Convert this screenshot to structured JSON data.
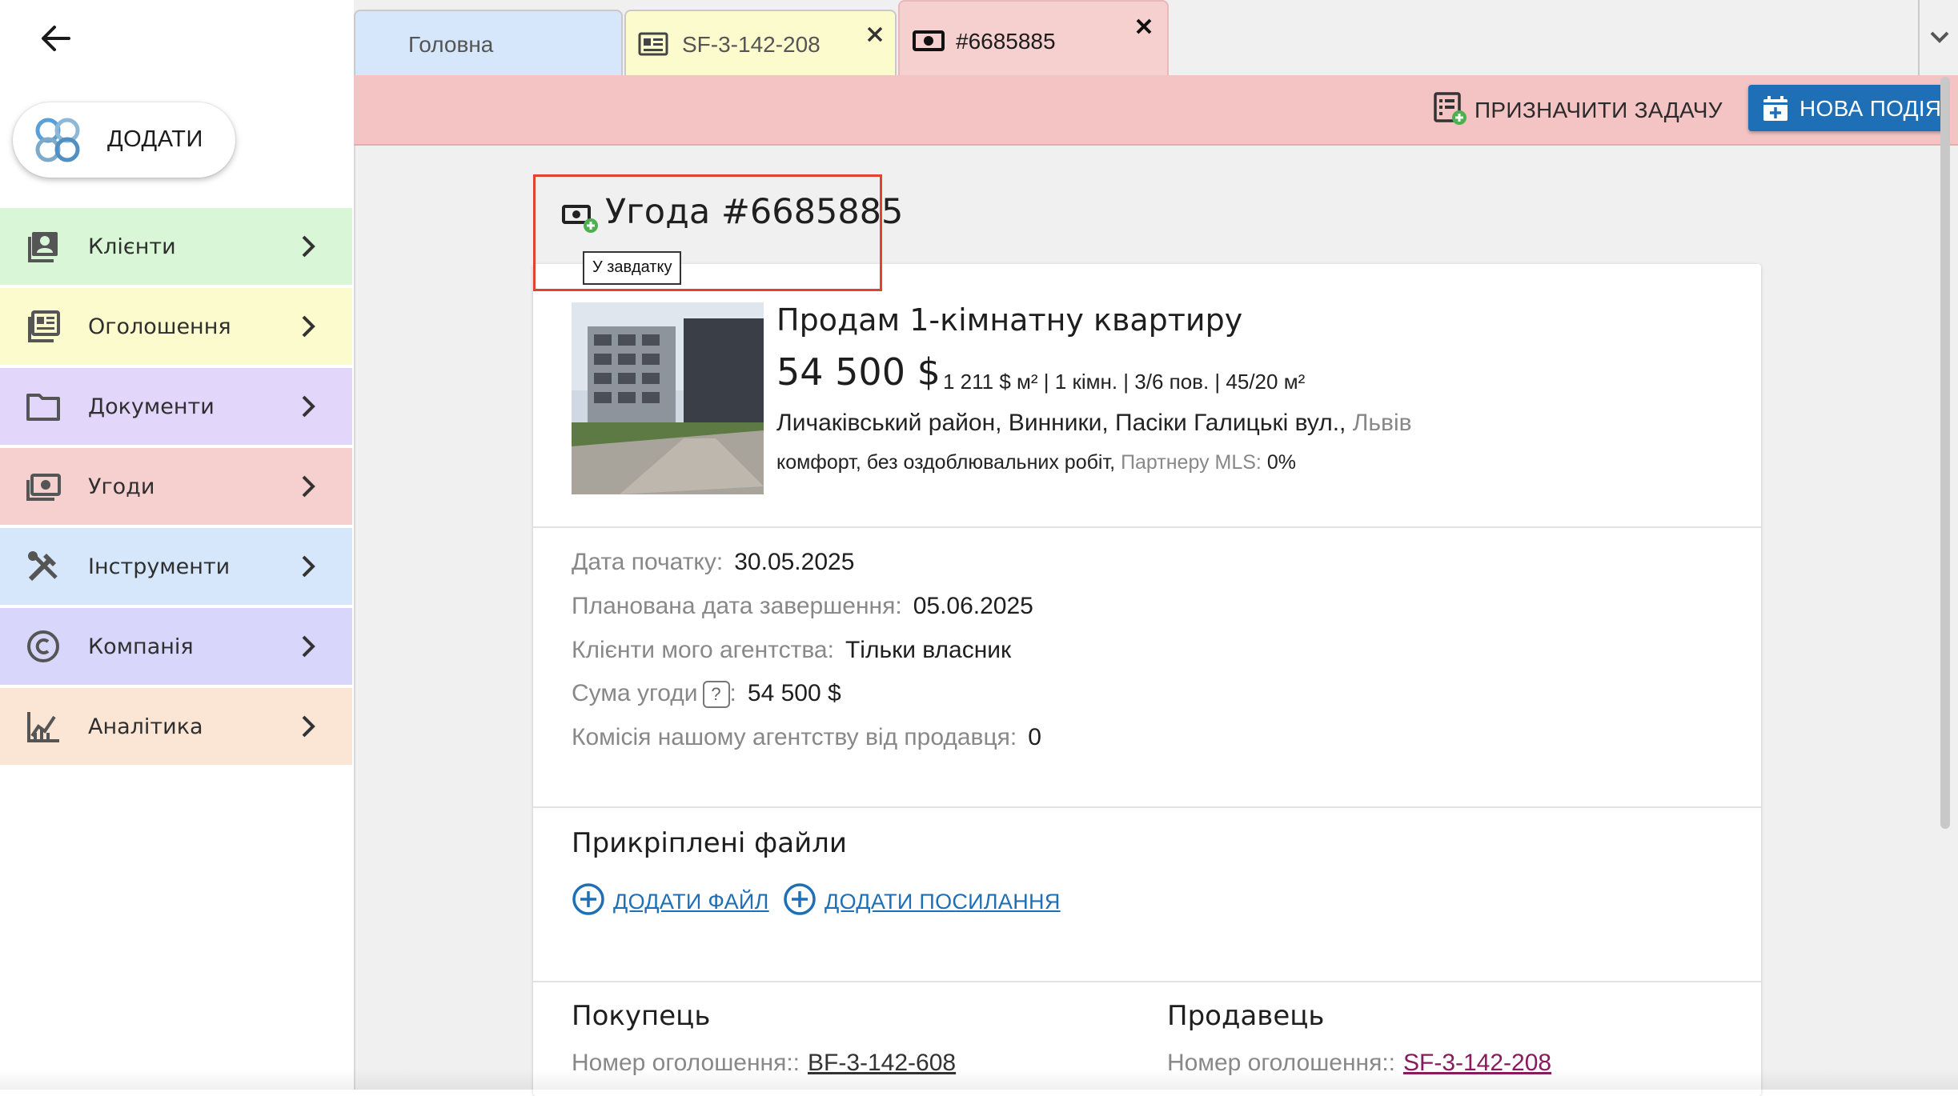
{
  "sidebar": {
    "add_label": "ДОДАТИ",
    "items": [
      {
        "label": "Клієнти",
        "bg": "#d9f7d6",
        "icon": "contacts-icon"
      },
      {
        "label": "Оголошення",
        "bg": "#fbfbce",
        "icon": "listing-icon"
      },
      {
        "label": "Документи",
        "bg": "#e2d6fb",
        "icon": "folder-icon"
      },
      {
        "label": "Угоди",
        "bg": "#f6cfcf",
        "icon": "deal-icon"
      },
      {
        "label": "Інструменти",
        "bg": "#d6e6fb",
        "icon": "tools-icon"
      },
      {
        "label": "Компанія",
        "bg": "#d8d6fb",
        "icon": "copyright-icon"
      },
      {
        "label": "Аналітика",
        "bg": "#fbe6d6",
        "icon": "analytics-icon"
      }
    ]
  },
  "tabs": [
    {
      "label": "Головна",
      "bg": "#d6e6fb"
    },
    {
      "label": "SF-3-142-208",
      "bg": "#fbfbce"
    },
    {
      "label": "#6685885",
      "bg": "#f6cfcf"
    }
  ],
  "actions": {
    "assign_task": "ПРИЗНАЧИТИ ЗАДАЧУ",
    "new_event": "НОВА ПОДІЯ"
  },
  "deal": {
    "title": "Угода #6685885",
    "status": "У завдатку"
  },
  "listing": {
    "title": "Продам 1-кімнатну квартиру",
    "price": "54 500 $",
    "specs": "1 211 $ м² | 1 кімн. | 3/6 пов. | 45/20 м²",
    "address": "Личаківський район, Винники, Пасіки Галицькі вул.,",
    "city": "Львів",
    "features": "комфорт, без оздоблювальних робіт,",
    "mls_label": "Партнеру MLS:",
    "mls_value": "0%"
  },
  "details": [
    {
      "label": "Дата початку:",
      "value": "30.05.2025"
    },
    {
      "label": "Планована дата завершення:",
      "value": "05.06.2025"
    },
    {
      "label": "Клієнти мого агентства:",
      "value": "Тільки власник"
    },
    {
      "label": "Сума угоди",
      "help": "?",
      "suffix": ":",
      "value": "54 500 $"
    },
    {
      "label": "Комісія нашому агентству від продавця:",
      "value": "0"
    }
  ],
  "files": {
    "title": "Прикріплені файли",
    "add_file": "ДОДАТИ ФАЙЛ",
    "add_link": "ДОДАТИ ПОСИЛАННЯ"
  },
  "buyer": {
    "title": "Покупець",
    "ref_label": "Номер оголошення::",
    "ref_value": "BF-3-142-608"
  },
  "seller": {
    "title": "Продавець",
    "ref_label": "Номер оголошення::",
    "ref_value": "SF-3-142-208"
  }
}
